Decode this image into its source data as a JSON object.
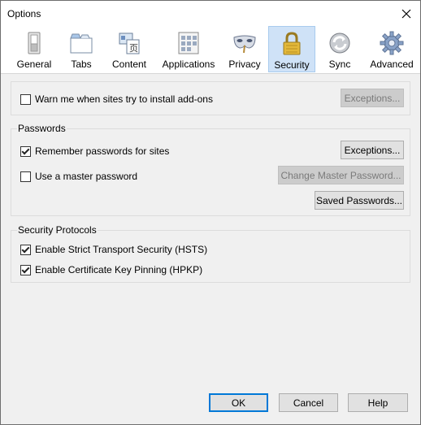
{
  "window": {
    "title": "Options"
  },
  "toolbar": {
    "items": [
      {
        "label": "General",
        "icon": "switch-icon"
      },
      {
        "label": "Tabs",
        "icon": "tabs-icon"
      },
      {
        "label": "Content",
        "icon": "content-icon"
      },
      {
        "label": "Applications",
        "icon": "applications-icon"
      },
      {
        "label": "Privacy",
        "icon": "mask-icon"
      },
      {
        "label": "Security",
        "icon": "padlock-icon",
        "selected": true
      },
      {
        "label": "Sync",
        "icon": "sync-icon"
      },
      {
        "label": "Advanced",
        "icon": "gear-icon"
      }
    ]
  },
  "addons": {
    "warn_label": "Warn me when sites try to install add-ons",
    "warn_checked": false,
    "exceptions_label": "Exceptions..."
  },
  "passwords": {
    "title": "Passwords",
    "remember_label": "Remember passwords for sites",
    "remember_checked": true,
    "exceptions_label": "Exceptions...",
    "master_label": "Use a master password",
    "master_checked": false,
    "change_master_label": "Change Master Password...",
    "saved_label": "Saved Passwords..."
  },
  "protocols": {
    "title": "Security Protocols",
    "hsts_label": "Enable Strict Transport Security (HSTS)",
    "hsts_checked": true,
    "hpkp_label": "Enable Certificate Key Pinning (HPKP)",
    "hpkp_checked": true
  },
  "footer": {
    "ok": "OK",
    "cancel": "Cancel",
    "help": "Help"
  },
  "colors": {
    "selected_tab": "#cfe2f7",
    "default_button_border": "#0078d7"
  }
}
